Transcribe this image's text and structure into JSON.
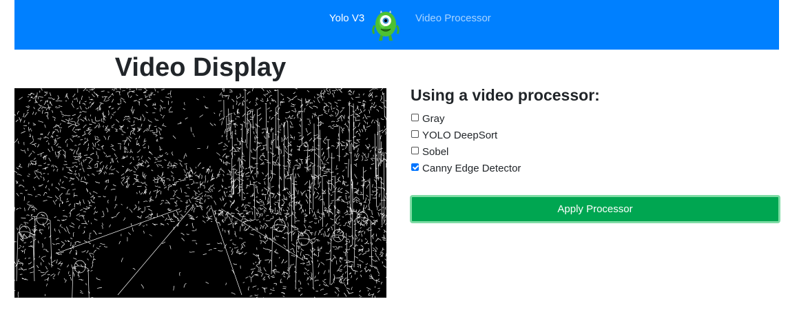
{
  "navbar": {
    "brand": "Yolo V3",
    "logo_icon": "one-eyed-green-monster-icon",
    "link": "Video Processor",
    "color": "#0080ff"
  },
  "video": {
    "title": "Video Display",
    "content": "canny-edge-street-frame"
  },
  "processor": {
    "title": "Using a video processor:",
    "options": [
      {
        "label": "Gray",
        "checked": false
      },
      {
        "label": "YOLO DeepSort",
        "checked": false
      },
      {
        "label": "Sobel",
        "checked": false
      },
      {
        "label": "Canny Edge Detector",
        "checked": true
      }
    ],
    "apply_label": "Apply Processor",
    "apply_color": "#00a651"
  }
}
